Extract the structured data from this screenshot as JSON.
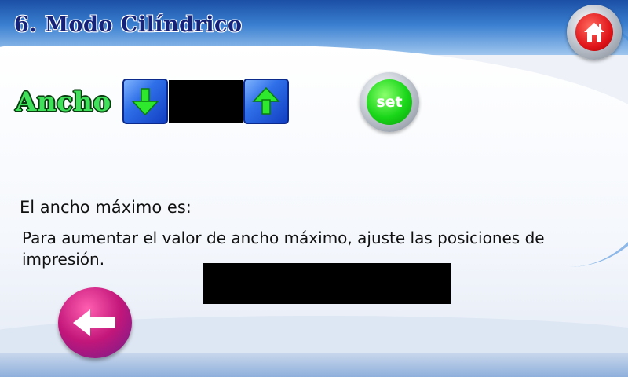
{
  "header": {
    "title": "6. Modo Cilíndrico",
    "home_icon": "home-icon"
  },
  "width_control": {
    "label": "Ancho",
    "value": "",
    "decrease_icon": "arrow-down-icon",
    "increase_icon": "arrow-up-icon",
    "set_label": "set"
  },
  "max_width": {
    "label": "El ancho máximo es:",
    "info": "Para aumentar el valor de ancho máximo, ajuste las posiciones de impresión.",
    "value": ""
  },
  "footer": {
    "back_icon": "arrow-left-icon"
  },
  "colors": {
    "title": "#15227a",
    "label_ancho": "#3fe05a",
    "arrow_button": "#2f6fe8",
    "set_button": "#19d619",
    "home_button": "#e0151a",
    "back_button": "#c2167a"
  }
}
